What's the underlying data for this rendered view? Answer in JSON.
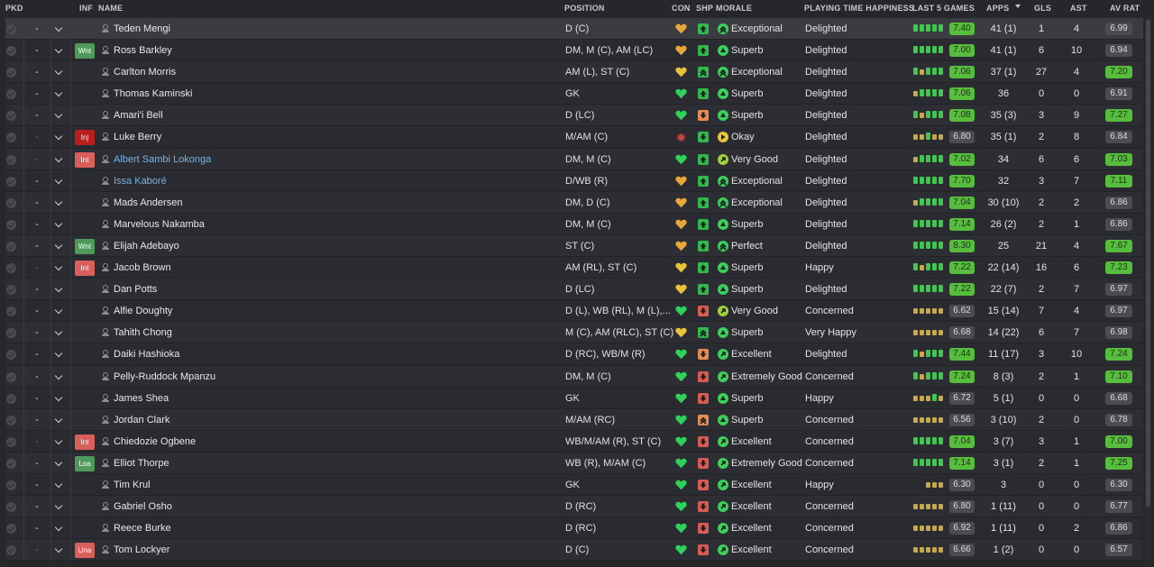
{
  "headers": {
    "pkd": "PKD",
    "inf": "INF",
    "name": "NAME",
    "position": "POSITION",
    "con": "CON",
    "shp": "SHP",
    "morale": "MORALE",
    "pth": "PLAYING TIME HAPPINESS",
    "last5": "LAST 5 GAMES",
    "apps": "APPS",
    "gls": "GLS",
    "ast": "AST",
    "avrat": "AV RAT"
  },
  "colors": {
    "background": "#26272b",
    "row": "#2d2e33",
    "rating_green": "#57be3d",
    "rating_grey": "#4b4c52",
    "link_blue": "#78b4e6",
    "heart_green": "#2fd15a",
    "heart_orange": "#e6a83b"
  },
  "players": [
    {
      "dash": "-",
      "dash_red": false,
      "inf": "",
      "name": "Teden Mengi",
      "link": false,
      "position": "D (C)",
      "con": "orange",
      "shp": "green",
      "shp_icon": "arrow-up",
      "morale_icon": "double-up",
      "morale_color": "green",
      "morale": "Exceptional",
      "pth": "Delighted",
      "form": [
        "g",
        "g",
        "g",
        "g",
        "g"
      ],
      "form_rating": "7.40",
      "form_green": true,
      "apps": "41 (1)",
      "gls": "1",
      "ast": "4",
      "avrat": "6.99",
      "avrat_green": false,
      "selected": true
    },
    {
      "dash": "-",
      "dash_red": false,
      "inf": "Wnt",
      "name": "Ross Barkley",
      "link": false,
      "position": "DM, M (C), AM (LC)",
      "con": "orange",
      "shp": "green",
      "shp_icon": "arrow-up",
      "morale_icon": "up",
      "morale_color": "green",
      "morale": "Superb",
      "pth": "Delighted",
      "form": [
        "g",
        "g",
        "g",
        "g",
        "g"
      ],
      "form_rating": "7.00",
      "form_green": true,
      "apps": "41 (1)",
      "gls": "6",
      "ast": "10",
      "avrat": "6.94",
      "avrat_green": false,
      "selected": false
    },
    {
      "dash": "-",
      "dash_red": false,
      "inf": "",
      "name": "Carlton Morris",
      "link": false,
      "position": "AM (L), ST (C)",
      "con": "yellow",
      "shp": "green",
      "shp_icon": "double-up",
      "morale_icon": "double-up",
      "morale_color": "green",
      "morale": "Exceptional",
      "pth": "Delighted",
      "form": [
        "g",
        "y",
        "g",
        "g",
        "g"
      ],
      "form_rating": "7.06",
      "form_green": true,
      "apps": "37 (1)",
      "gls": "27",
      "ast": "4",
      "avrat": "7.20",
      "avrat_green": true,
      "selected": false
    },
    {
      "dash": "-",
      "dash_red": false,
      "inf": "",
      "name": "Thomas Kaminski",
      "link": false,
      "position": "GK",
      "con": "green",
      "shp": "green",
      "shp_icon": "arrow-up",
      "morale_icon": "up",
      "morale_color": "green",
      "morale": "Superb",
      "pth": "Delighted",
      "form": [
        "y",
        "g",
        "g",
        "g",
        "g"
      ],
      "form_rating": "7.06",
      "form_green": true,
      "apps": "36",
      "gls": "0",
      "ast": "0",
      "avrat": "6.91",
      "avrat_green": false,
      "selected": false
    },
    {
      "dash": "-",
      "dash_red": false,
      "inf": "",
      "name": "Amari'i Bell",
      "link": false,
      "position": "D (LC)",
      "con": "green",
      "shp": "orange",
      "shp_icon": "arrow-down",
      "morale_icon": "up",
      "morale_color": "green",
      "morale": "Superb",
      "pth": "Delighted",
      "form": [
        "g",
        "y",
        "g",
        "g",
        "g"
      ],
      "form_rating": "7.08",
      "form_green": true,
      "apps": "35 (3)",
      "gls": "3",
      "ast": "9",
      "avrat": "7.27",
      "avrat_green": true,
      "selected": false
    },
    {
      "dash": "-",
      "dash_red": true,
      "inf": "Inj",
      "name": "Luke Berry",
      "link": false,
      "position": "M/AM (C)",
      "con": "redball",
      "shp": "green",
      "shp_icon": "arrow-down",
      "morale_icon": "right",
      "morale_color": "yellow",
      "morale": "Okay",
      "pth": "Delighted",
      "form": [
        "y",
        "y",
        "g",
        "y",
        "y"
      ],
      "form_rating": "6.80",
      "form_green": false,
      "apps": "35 (1)",
      "gls": "2",
      "ast": "8",
      "avrat": "6.84",
      "avrat_green": false,
      "selected": false
    },
    {
      "dash": "-",
      "dash_red": true,
      "inf": "Int",
      "name": "Albert Sambi Lokonga",
      "link": true,
      "position": "DM, M (C)",
      "con": "green",
      "shp": "green",
      "shp_icon": "arrow-up",
      "morale_icon": "upright",
      "morale_color": "lime",
      "morale": "Very Good",
      "pth": "Delighted",
      "form": [
        "y",
        "g",
        "g",
        "g",
        "g"
      ],
      "form_rating": "7.02",
      "form_green": true,
      "apps": "34",
      "gls": "6",
      "ast": "6",
      "avrat": "7.03",
      "avrat_green": true,
      "selected": false
    },
    {
      "dash": "-",
      "dash_red": false,
      "inf": "",
      "name": "Issa Kaboré",
      "link": true,
      "position": "D/WB (R)",
      "con": "orange",
      "shp": "green",
      "shp_icon": "arrow-up",
      "morale_icon": "double-up",
      "morale_color": "green",
      "morale": "Exceptional",
      "pth": "Delighted",
      "form": [
        "g",
        "g",
        "g",
        "g",
        "g"
      ],
      "form_rating": "7.70",
      "form_green": true,
      "apps": "32",
      "gls": "3",
      "ast": "7",
      "avrat": "7.11",
      "avrat_green": true,
      "selected": false
    },
    {
      "dash": "-",
      "dash_red": false,
      "inf": "",
      "name": "Mads Andersen",
      "link": false,
      "position": "DM, D (C)",
      "con": "orange",
      "shp": "green",
      "shp_icon": "arrow-up",
      "morale_icon": "double-up",
      "morale_color": "green",
      "morale": "Exceptional",
      "pth": "Delighted",
      "form": [
        "y",
        "g",
        "g",
        "g",
        "g"
      ],
      "form_rating": "7.04",
      "form_green": true,
      "apps": "30 (10)",
      "gls": "2",
      "ast": "2",
      "avrat": "6.86",
      "avrat_green": false,
      "selected": false
    },
    {
      "dash": "-",
      "dash_red": false,
      "inf": "",
      "name": "Marvelous Nakamba",
      "link": false,
      "position": "DM, M (C)",
      "con": "orange",
      "shp": "green",
      "shp_icon": "arrow-up",
      "morale_icon": "up",
      "morale_color": "green",
      "morale": "Superb",
      "pth": "Delighted",
      "form": [
        "g",
        "g",
        "g",
        "g",
        "g"
      ],
      "form_rating": "7.14",
      "form_green": true,
      "apps": "26 (2)",
      "gls": "2",
      "ast": "1",
      "avrat": "6.86",
      "avrat_green": false,
      "selected": false
    },
    {
      "dash": "-",
      "dash_red": false,
      "inf": "Wnt",
      "name": "Elijah Adebayo",
      "link": false,
      "position": "ST (C)",
      "con": "orange",
      "shp": "green",
      "shp_icon": "arrow-up",
      "morale_icon": "double-up",
      "morale_color": "green",
      "morale": "Perfect",
      "pth": "Delighted",
      "form": [
        "g",
        "g",
        "g",
        "g",
        "g"
      ],
      "form_rating": "8.30",
      "form_green": true,
      "apps": "25",
      "gls": "21",
      "ast": "4",
      "avrat": "7.67",
      "avrat_green": true,
      "selected": false
    },
    {
      "dash": "-",
      "dash_red": true,
      "inf": "Int",
      "name": "Jacob Brown",
      "link": false,
      "position": "AM (RL), ST (C)",
      "con": "yellow",
      "shp": "green",
      "shp_icon": "arrow-up",
      "morale_icon": "up",
      "morale_color": "green",
      "morale": "Superb",
      "pth": "Happy",
      "form": [
        "g",
        "y",
        "g",
        "g",
        "g"
      ],
      "form_rating": "7.22",
      "form_green": true,
      "apps": "22 (14)",
      "gls": "16",
      "ast": "6",
      "avrat": "7.23",
      "avrat_green": true,
      "selected": false
    },
    {
      "dash": "-",
      "dash_red": false,
      "inf": "",
      "name": "Dan Potts",
      "link": false,
      "position": "D (LC)",
      "con": "yellow",
      "shp": "green",
      "shp_icon": "arrow-up",
      "morale_icon": "up",
      "morale_color": "green",
      "morale": "Superb",
      "pth": "Delighted",
      "form": [
        "g",
        "g",
        "g",
        "g",
        "g"
      ],
      "form_rating": "7.22",
      "form_green": true,
      "apps": "22 (7)",
      "gls": "2",
      "ast": "7",
      "avrat": "6.97",
      "avrat_green": false,
      "selected": false
    },
    {
      "dash": "-",
      "dash_red": false,
      "inf": "",
      "name": "Alfie Doughty",
      "link": false,
      "position": "D (L), WB (RL), M (L),...",
      "con": "green",
      "shp": "red",
      "shp_icon": "arrow-down",
      "morale_icon": "upright",
      "morale_color": "lime",
      "morale": "Very Good",
      "pth": "Concerned",
      "form": [
        "y",
        "y",
        "y",
        "y",
        "y"
      ],
      "form_rating": "6.62",
      "form_green": false,
      "apps": "15 (14)",
      "gls": "7",
      "ast": "4",
      "avrat": "6.97",
      "avrat_green": false,
      "selected": false
    },
    {
      "dash": "-",
      "dash_red": false,
      "inf": "",
      "name": "Tahith Chong",
      "link": false,
      "position": "M (C), AM (RLC), ST (C)",
      "con": "yellow",
      "shp": "green",
      "shp_icon": "double-up",
      "morale_icon": "up",
      "morale_color": "green",
      "morale": "Superb",
      "pth": "Very Happy",
      "form": [
        "y",
        "y",
        "y",
        "y",
        "y"
      ],
      "form_rating": "6.68",
      "form_green": false,
      "apps": "14 (22)",
      "gls": "6",
      "ast": "7",
      "avrat": "6.98",
      "avrat_green": false,
      "selected": false
    },
    {
      "dash": "-",
      "dash_red": false,
      "inf": "",
      "name": "Daiki Hashioka",
      "link": false,
      "position": "D (RC), WB/M (R)",
      "con": "green",
      "shp": "orange",
      "shp_icon": "arrow-down",
      "morale_icon": "upright",
      "morale_color": "green",
      "morale": "Excellent",
      "pth": "Delighted",
      "form": [
        "g",
        "y",
        "g",
        "g",
        "g"
      ],
      "form_rating": "7.44",
      "form_green": true,
      "apps": "11 (17)",
      "gls": "3",
      "ast": "10",
      "avrat": "7.24",
      "avrat_green": true,
      "selected": false
    },
    {
      "dash": "-",
      "dash_red": false,
      "inf": "",
      "name": "Pelly-Ruddock Mpanzu",
      "link": false,
      "position": "DM, M (C)",
      "con": "green",
      "shp": "red",
      "shp_icon": "arrow-down",
      "morale_icon": "upright",
      "morale_color": "green",
      "morale": "Extremely Good",
      "pth": "Concerned",
      "form": [
        "g",
        "y",
        "g",
        "g",
        "g"
      ],
      "form_rating": "7.24",
      "form_green": true,
      "apps": "8 (3)",
      "gls": "2",
      "ast": "1",
      "avrat": "7.10",
      "avrat_green": true,
      "selected": false
    },
    {
      "dash": "-",
      "dash_red": false,
      "inf": "",
      "name": "James Shea",
      "link": false,
      "position": "GK",
      "con": "green",
      "shp": "red",
      "shp_icon": "arrow-down",
      "morale_icon": "up",
      "morale_color": "green",
      "morale": "Superb",
      "pth": "Happy",
      "form": [
        "y",
        "y",
        "y",
        "g",
        "y"
      ],
      "form_rating": "6.72",
      "form_green": false,
      "apps": "5 (1)",
      "gls": "0",
      "ast": "0",
      "avrat": "6.68",
      "avrat_green": false,
      "selected": false
    },
    {
      "dash": "-",
      "dash_red": false,
      "inf": "",
      "name": "Jordan Clark",
      "link": false,
      "position": "M/AM (RC)",
      "con": "green",
      "shp": "orange",
      "shp_icon": "double-up",
      "morale_icon": "up",
      "morale_color": "green",
      "morale": "Superb",
      "pth": "Concerned",
      "form": [
        "y",
        "y",
        "y",
        "y",
        "y"
      ],
      "form_rating": "6.56",
      "form_green": false,
      "apps": "3 (10)",
      "gls": "2",
      "ast": "0",
      "avrat": "6.78",
      "avrat_green": false,
      "selected": false
    },
    {
      "dash": "-",
      "dash_red": true,
      "inf": "Int",
      "name": "Chiedozie Ogbene",
      "link": false,
      "position": "WB/M/AM (R), ST (C)",
      "con": "green",
      "shp": "red",
      "shp_icon": "arrow-down",
      "morale_icon": "upright",
      "morale_color": "green",
      "morale": "Excellent",
      "pth": "Concerned",
      "form": [
        "g",
        "g",
        "g",
        "g",
        "g"
      ],
      "form_rating": "7.04",
      "form_green": true,
      "apps": "3 (7)",
      "gls": "3",
      "ast": "1",
      "avrat": "7.00",
      "avrat_green": true,
      "selected": false
    },
    {
      "dash": "-",
      "dash_red": false,
      "inf": "Loa",
      "name": "Elliot Thorpe",
      "link": false,
      "position": "WB (R), M/AM (C)",
      "con": "green",
      "shp": "red",
      "shp_icon": "arrow-down",
      "morale_icon": "upright",
      "morale_color": "green",
      "morale": "Extremely Good",
      "pth": "Concerned",
      "form": [
        "g",
        "g",
        "g",
        "g",
        "g"
      ],
      "form_rating": "7.14",
      "form_green": true,
      "apps": "3 (1)",
      "gls": "2",
      "ast": "1",
      "avrat": "7.25",
      "avrat_green": true,
      "selected": false
    },
    {
      "dash": "-",
      "dash_red": false,
      "inf": "",
      "name": "Tim Krul",
      "link": false,
      "position": "GK",
      "con": "green",
      "shp": "red",
      "shp_icon": "arrow-down",
      "morale_icon": "upright",
      "morale_color": "green",
      "morale": "Excellent",
      "pth": "Happy",
      "form": [
        "y",
        "y",
        "y"
      ],
      "form_rating": "6.30",
      "form_green": false,
      "apps": "3",
      "gls": "0",
      "ast": "0",
      "avrat": "6.30",
      "avrat_green": false,
      "selected": false
    },
    {
      "dash": "-",
      "dash_red": false,
      "inf": "",
      "name": "Gabriel Osho",
      "link": false,
      "position": "D (RC)",
      "con": "green",
      "shp": "red",
      "shp_icon": "arrow-down",
      "morale_icon": "upright",
      "morale_color": "green",
      "morale": "Excellent",
      "pth": "Concerned",
      "form": [
        "y",
        "y",
        "y",
        "y",
        "y"
      ],
      "form_rating": "6.80",
      "form_green": false,
      "apps": "1 (11)",
      "gls": "0",
      "ast": "0",
      "avrat": "6.77",
      "avrat_green": false,
      "selected": false
    },
    {
      "dash": "-",
      "dash_red": false,
      "inf": "",
      "name": "Reece Burke",
      "link": false,
      "position": "D (RC)",
      "con": "green",
      "shp": "red",
      "shp_icon": "arrow-down",
      "morale_icon": "upright",
      "morale_color": "green",
      "morale": "Excellent",
      "pth": "Concerned",
      "form": [
        "y",
        "y",
        "y",
        "y",
        "y"
      ],
      "form_rating": "6.92",
      "form_green": false,
      "apps": "1 (11)",
      "gls": "0",
      "ast": "2",
      "avrat": "6.86",
      "avrat_green": false,
      "selected": false
    },
    {
      "dash": "-",
      "dash_red": true,
      "inf": "Una",
      "name": "Tom Lockyer",
      "link": false,
      "position": "D (C)",
      "con": "green",
      "shp": "red",
      "shp_icon": "arrow-down",
      "morale_icon": "upright",
      "morale_color": "green",
      "morale": "Excellent",
      "pth": "Concerned",
      "form": [
        "y",
        "y",
        "y",
        "y",
        "y"
      ],
      "form_rating": "6.66",
      "form_green": false,
      "apps": "1 (2)",
      "gls": "0",
      "ast": "0",
      "avrat": "6.57",
      "avrat_green": false,
      "selected": false
    }
  ]
}
